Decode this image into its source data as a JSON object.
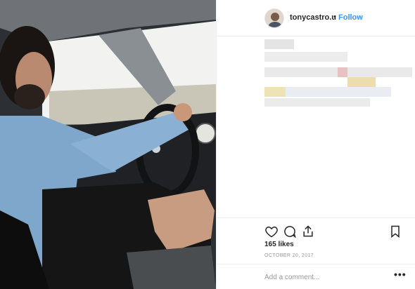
{
  "post": {
    "photo_description_icon": "post-photo",
    "header": {
      "username": "tonycastro.u",
      "separator": "•",
      "follow_label": "Follow"
    },
    "actions": {
      "like_icon": "heart-icon",
      "comment_icon": "comment-icon",
      "share_icon": "share-icon",
      "save_icon": "bookmark-icon"
    },
    "likes_text": "165 likes",
    "date_text": "OCTOBER 20, 2017",
    "comment": {
      "placeholder": "Add a comment...",
      "more_label": "•••"
    }
  },
  "colors": {
    "follow_blue": "#3897f0",
    "divider": "#efefef",
    "muted_text": "#999999",
    "primary_text": "#262626"
  }
}
